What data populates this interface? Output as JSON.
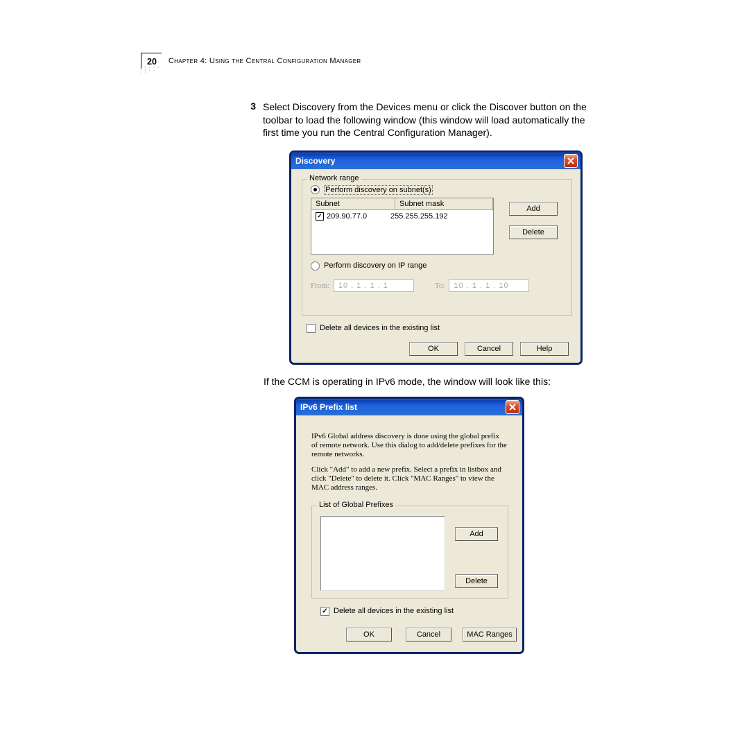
{
  "page": {
    "number": "20",
    "chapter": "Chapter 4: Using the Central Configuration Manager"
  },
  "step": {
    "number": "3",
    "text": "Select Discovery from the Devices menu or click the Discover button on the toolbar to load the following window (this window will load automatically the first time you run the Central Configuration Manager)."
  },
  "dialog1": {
    "title": "Discovery",
    "group_label": "Network range",
    "radio_subnets": "Perform discovery on subnet(s)",
    "col_subnet": "Subnet",
    "col_mask": "Subnet mask",
    "row_subnet": "209.90.77.0",
    "row_mask": "255.255.255.192",
    "add": "Add",
    "delete": "Delete",
    "radio_iprange": "Perform discovery on IP range",
    "from_label": "From:",
    "from_value": "10 .  1  .  1 .  1",
    "to_label": "To:",
    "to_value": "10 .  1 .  1 .  10",
    "delete_all": "Delete all devices in the existing list",
    "ok": "OK",
    "cancel": "Cancel",
    "help": "Help"
  },
  "mid_text": "If the CCM is operating in IPv6 mode, the window will look like this:",
  "dialog2": {
    "title": "IPv6 Prefix list",
    "para1": "IPv6 Global address discovery is done using the global prefix of remote network. Use this dialog to add/delete prefixes  for the remote networks.",
    "para2": "Click \"Add\" to add a new prefix. Select a prefix in listbox and click \"Delete\" to delete it. Click \"MAC Ranges\" to view the MAC address ranges.",
    "group_label": "List of Global Prefixes",
    "add": "Add",
    "delete": "Delete",
    "delete_all": "Delete all devices in the existing list",
    "ok": "OK",
    "cancel": "Cancel",
    "mac": "MAC Ranges"
  }
}
